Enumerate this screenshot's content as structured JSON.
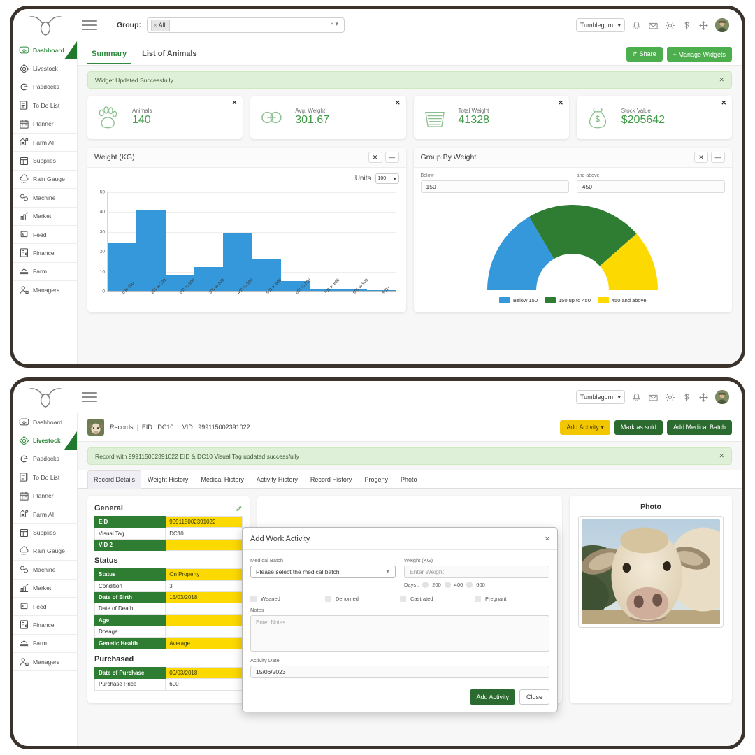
{
  "app": {
    "logo_icon": "bull-head-logo",
    "menu_icon": "hamburger-menu-icon"
  },
  "top_window": {
    "group_filter": {
      "label": "Group:",
      "selected_tag": "All",
      "tag_remove_icon": "remove-tag-icon",
      "clear_icon": "clear-selection-icon",
      "caret_icon": "chevron-down-icon"
    },
    "header_right": {
      "org": "Tumblegum",
      "org_caret_icon": "chevron-down-icon",
      "icons": [
        "notification-bell-icon",
        "mail-icon",
        "settings-gear-icon",
        "dollar-icon",
        "expand-arrows-icon"
      ],
      "avatar_icon": "user-avatar"
    },
    "tabs": [
      {
        "label": "Summary",
        "active": true
      },
      {
        "label": "List of Animals",
        "active": false
      }
    ],
    "actions": [
      {
        "label": "Share",
        "icon": "share-icon",
        "style": "green"
      },
      {
        "label": "Manage Widgets",
        "icon": "plus-icon",
        "style": "green"
      }
    ],
    "alert": {
      "message": "Widget Updated Successfully",
      "close_icon": "close-icon"
    },
    "kpis": [
      {
        "icon": "paw-print-icon",
        "label": "Animals",
        "value": "140",
        "close_icon": "close-icon"
      },
      {
        "icon": "chain-link-icon",
        "label": "Avg. Weight",
        "value": "301.67",
        "close_icon": "close-icon"
      },
      {
        "icon": "basket-icon",
        "label": "Total Weight",
        "value": "41328",
        "close_icon": "close-icon"
      },
      {
        "icon": "money-bag-icon",
        "label": "Stock Value",
        "value": "$205642",
        "close_icon": "close-icon"
      }
    ],
    "weight_widget": {
      "title": "Weight (KG)",
      "close_icon": "close-icon",
      "minimize_icon": "minimize-icon",
      "units_label": "Units",
      "units_value": "100"
    },
    "group_widget": {
      "title": "Group By Weight",
      "close_icon": "close-icon",
      "minimize_icon": "minimize-icon",
      "below_label": "Below",
      "below_value": "150",
      "above_label": "and above",
      "above_value": "450"
    }
  },
  "chart_data": [
    {
      "type": "bar",
      "title": "Weight (KG)",
      "categories": [
        "0 to 100",
        "101 to 200",
        "201 to 300",
        "301 to 400",
        "401 to 500",
        "501 to 600",
        "601 to 700",
        "701 to 800",
        "801 to 900",
        "901+"
      ],
      "values": [
        24,
        41,
        8,
        12,
        29,
        16,
        5,
        1,
        1,
        0
      ],
      "yticks": [
        0,
        10,
        20,
        30,
        40,
        50
      ],
      "ylim": [
        0,
        50
      ],
      "xlabel": "",
      "ylabel": "",
      "grid": true,
      "bar_color": "#3498db"
    },
    {
      "type": "pie",
      "subtype": "half-donut-gauge",
      "title": "Group By Weight",
      "categories": [
        "Below 150",
        "150 up to 450",
        "450 and above"
      ],
      "values": [
        33,
        44,
        23
      ],
      "colors": [
        "#3498db",
        "#2e7d32",
        "#fcd900"
      ],
      "legend": [
        "Below 150",
        "150 up to 450",
        "450 and above"
      ],
      "legend_position": "bottom"
    }
  ],
  "sidebar": {
    "items": [
      {
        "label": "Dashboard",
        "icon": "dashboard-gauge-icon"
      },
      {
        "label": "Livestock",
        "icon": "livestock-diamond-icon"
      },
      {
        "label": "Paddocks",
        "icon": "paddocks-cycle-icon"
      },
      {
        "label": "To Do List",
        "icon": "todo-list-icon"
      },
      {
        "label": "Planner",
        "icon": "planner-calendar-icon"
      },
      {
        "label": "Farm AI",
        "icon": "farm-ai-icon"
      },
      {
        "label": "Supplies",
        "icon": "supplies-box-icon"
      },
      {
        "label": "Rain Gauge",
        "icon": "rain-cloud-icon"
      },
      {
        "label": "Machine",
        "icon": "machine-icon"
      },
      {
        "label": "Market",
        "icon": "market-chart-icon"
      },
      {
        "label": "Feed",
        "icon": "feed-icon"
      },
      {
        "label": "Finance",
        "icon": "finance-icon"
      },
      {
        "label": "Farm",
        "icon": "farm-field-icon"
      },
      {
        "label": "Managers",
        "icon": "managers-person-icon"
      }
    ],
    "top_active": "Dashboard",
    "bottom_active": "Livestock"
  },
  "bottom_window": {
    "header_right": {
      "org": "Tumblegum",
      "org_caret_icon": "chevron-down-icon",
      "icons": [
        "notification-bell-icon",
        "mail-icon",
        "settings-gear-icon",
        "dollar-icon",
        "expand-arrows-icon"
      ],
      "avatar_icon": "user-avatar"
    },
    "record_bar": {
      "thumb_icon": "animal-thumbnail",
      "breadcrumb_label": "Records",
      "eid_label": "EID : DC10",
      "vid_label": "VID : 999115002391022",
      "actions": [
        {
          "label": "Add Activity",
          "style": "yellow",
          "caret_icon": "chevron-down-icon"
        },
        {
          "label": "Mark as sold",
          "style": "darkgreen"
        },
        {
          "label": "Add Medical Batch",
          "style": "darkgreen"
        }
      ]
    },
    "alert": {
      "message": "Record with 999115002391022 EID & DC10 Visual Tag updated successfully",
      "close_icon": "close-icon"
    },
    "tabs": [
      {
        "label": "Record Details",
        "active": true
      },
      {
        "label": "Weight History",
        "active": false
      },
      {
        "label": "Medical History",
        "active": false
      },
      {
        "label": "Activity History",
        "active": false
      },
      {
        "label": "Record History",
        "active": false
      },
      {
        "label": "Progeny",
        "active": false
      },
      {
        "label": "Photo",
        "active": false
      }
    ],
    "details": {
      "general": {
        "title": "General",
        "edit_icon": "pencil-edit-icon",
        "rows": [
          {
            "key": "EID",
            "value": "999115002391022",
            "key_hl": true,
            "val_hl": true
          },
          {
            "key": "Visual Tag",
            "value": "DC10",
            "key_hl": false,
            "val_hl": false
          },
          {
            "key": "VID 2",
            "value": "",
            "key_hl": true,
            "val_hl": true
          }
        ]
      },
      "status": {
        "title": "Status",
        "rows": [
          {
            "key": "Status",
            "value": "On Property",
            "key_hl": true,
            "val_hl": true
          },
          {
            "key": "Condition",
            "value": "3",
            "key_hl": false,
            "val_hl": false
          },
          {
            "key": "Date of Birth",
            "value": "15/03/2018",
            "key_hl": true,
            "val_hl": true
          },
          {
            "key": "Date of Death",
            "value": "",
            "key_hl": false,
            "val_hl": false
          },
          {
            "key": "Age",
            "value": "",
            "key_hl": true,
            "val_hl": true
          },
          {
            "key": "Dosage",
            "value": "",
            "key_hl": false,
            "val_hl": false
          },
          {
            "key": "Genetic Health",
            "value": "Average",
            "key_hl": true,
            "val_hl": true
          }
        ]
      },
      "purchased": {
        "title": "Purchased",
        "rows": [
          {
            "key": "Date of Purchase",
            "value": "09/03/2018",
            "key_hl": true,
            "val_hl": true
          },
          {
            "key": "Purchase Price",
            "value": "600",
            "key_hl": false,
            "val_hl": false
          }
        ]
      }
    },
    "photo_panel": {
      "title": "Photo",
      "image_icon": "cow-photo"
    },
    "modal": {
      "title": "Add Work Activity",
      "close_icon": "close-icon",
      "medical_batch_label": "Medical Batch",
      "medical_batch_value": "Please select the medical batch",
      "weight_label": "Weight (KG)",
      "weight_placeholder": "Enter Weight",
      "days_label": "Days :",
      "days_options": [
        "200",
        "400",
        "600"
      ],
      "checkboxes": [
        "Weaned",
        "Dehorned",
        "Castrated",
        "Pregnant"
      ],
      "notes_label": "Notes",
      "notes_placeholder": "Enter Notes",
      "activity_date_label": "Activity Date",
      "activity_date_value": "15/06/2023",
      "submit_label": "Add Activity",
      "cancel_label": "Close"
    }
  },
  "colors": {
    "brand_green": "#2f8a3f",
    "dark_green": "#2c6b2f",
    "accent_yellow": "#fcd900",
    "chart_blue": "#3498db",
    "alert_bg": "#dff0d8"
  }
}
